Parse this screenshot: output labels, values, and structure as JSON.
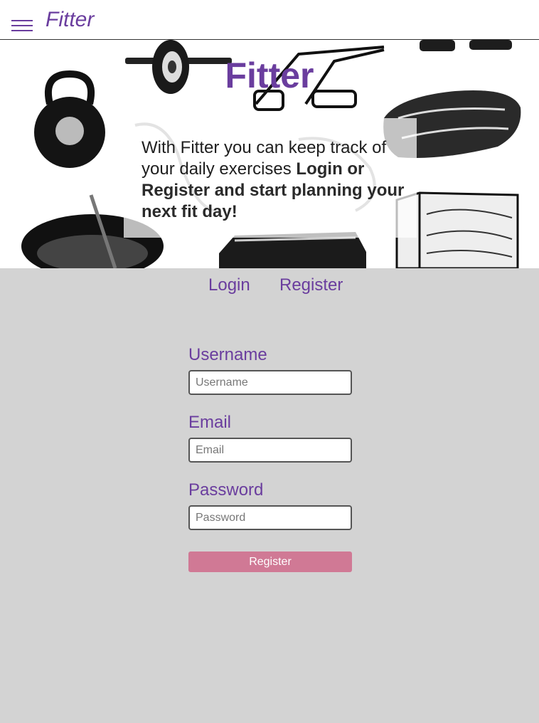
{
  "header": {
    "brand": "Fitter"
  },
  "hero": {
    "title": "Fitter",
    "intro_plain": "With Fitter you can keep track of your daily exercises ",
    "intro_bold": "Login or Register and start planning your next fit day!"
  },
  "tabs": {
    "login_label": "Login",
    "register_label": "Register"
  },
  "form": {
    "username_label": "Username",
    "username_placeholder": "Username",
    "username_value": "",
    "email_label": "Email",
    "email_placeholder": "Email",
    "email_value": "",
    "password_label": "Password",
    "password_placeholder": "Password",
    "password_value": "",
    "submit_label": "Register"
  },
  "icons": {
    "menu": "hamburger-menu-icon"
  },
  "colors": {
    "brand": "#6a3d9e",
    "page_background": "#d3d3d3",
    "button": "#d07995"
  }
}
